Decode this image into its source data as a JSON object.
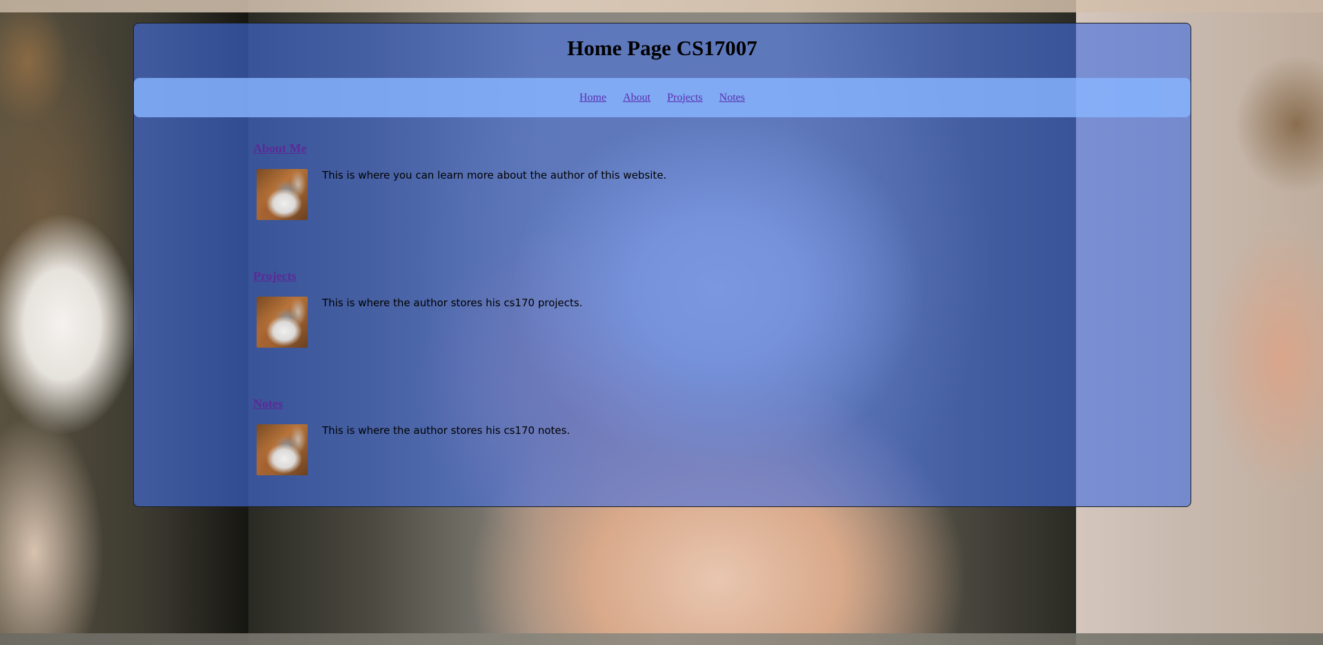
{
  "page": {
    "title": "Home Page CS17007"
  },
  "nav": {
    "items": [
      {
        "label": "Home"
      },
      {
        "label": "About"
      },
      {
        "label": "Projects"
      },
      {
        "label": "Notes"
      }
    ]
  },
  "sections": [
    {
      "heading": "About Me",
      "text": "This is where you can learn more about the author of this website."
    },
    {
      "heading": "Projects",
      "text": "This is where the author stores his cs170 projects."
    },
    {
      "heading": "Notes",
      "text": "This is where the author stores his cs170 notes."
    }
  ],
  "colors": {
    "panel": "#426ee1",
    "nav_bar": "#87b4ff",
    "link": "#5a2fb0"
  }
}
